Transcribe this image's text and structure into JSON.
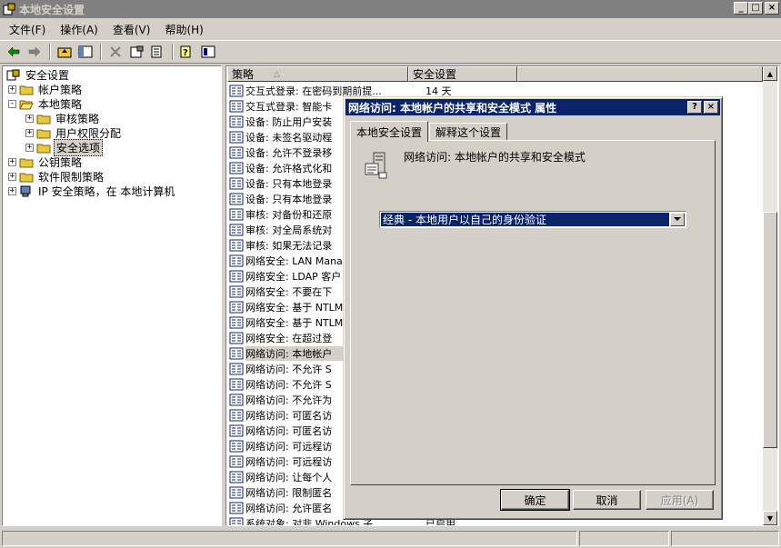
{
  "window": {
    "title": "本地安全设置",
    "min_glyph": "_",
    "max_glyph": "□",
    "close_glyph": "×"
  },
  "menu": [
    "文件(F)",
    "操作(A)",
    "查看(V)",
    "帮助(H)"
  ],
  "toolbar": {
    "icons": [
      "back-arrow-icon",
      "forward-arrow-icon",
      "up-folder-icon",
      "show-tree-icon",
      "delete-icon",
      "properties-icon",
      "export-list-icon",
      "help-icon",
      "console-icon"
    ]
  },
  "tree": {
    "root": "安全设置",
    "items": [
      {
        "label": "帐户策略",
        "level": 1,
        "expander": "+"
      },
      {
        "label": "本地策略",
        "level": 1,
        "expander": "-"
      },
      {
        "label": "审核策略",
        "level": 2,
        "expander": "+"
      },
      {
        "label": "用户权限分配",
        "level": 2,
        "expander": "+"
      },
      {
        "label": "安全选项",
        "level": 2,
        "expander": "+",
        "selected": true
      },
      {
        "label": "公钥策略",
        "level": 1,
        "expander": "+"
      },
      {
        "label": "软件限制策略",
        "level": 1,
        "expander": "+"
      },
      {
        "label": "IP 安全策略，在 本地计算机",
        "level": 1,
        "expander": "+"
      }
    ]
  },
  "list": {
    "columns": [
      "策略",
      "安全设置"
    ],
    "rows": [
      {
        "name": "交互式登录: 在密码到期前提...",
        "value": "14 天"
      },
      {
        "name": "交互式登录: 智能卡",
        "value": ""
      },
      {
        "name": "设备: 防止用户安装",
        "value": ""
      },
      {
        "name": "设备: 未签名驱动程",
        "value": ""
      },
      {
        "name": "设备: 允许不登录移",
        "value": ""
      },
      {
        "name": "设备: 允许格式化和",
        "value": ""
      },
      {
        "name": "设备: 只有本地登录",
        "value": ""
      },
      {
        "name": "设备: 只有本地登录",
        "value": ""
      },
      {
        "name": "审核: 对备份和还原",
        "value": ""
      },
      {
        "name": "审核: 对全局系统对",
        "value": ""
      },
      {
        "name": "审核: 如果无法记录",
        "value": ""
      },
      {
        "name": "网络安全: LAN Mana",
        "value": ""
      },
      {
        "name": "网络安全: LDAP 客户",
        "value": ""
      },
      {
        "name": "网络安全: 不要在下",
        "value": ""
      },
      {
        "name": "网络安全: 基于 NTLM",
        "value": ""
      },
      {
        "name": "网络安全: 基于 NTLM",
        "value": ""
      },
      {
        "name": "网络安全: 在超过登",
        "value": ""
      },
      {
        "name": "网络访问: 本地帐户",
        "value": "",
        "highlight": true
      },
      {
        "name": "网络访问: 不允许 S",
        "value": ""
      },
      {
        "name": "网络访问: 不允许 S",
        "value": ""
      },
      {
        "name": "网络访问: 不允许为",
        "value": ""
      },
      {
        "name": "网络访问: 可匿名访",
        "value": ""
      },
      {
        "name": "网络访问: 可匿名访",
        "value": ""
      },
      {
        "name": "网络访问: 可远程访",
        "value": ""
      },
      {
        "name": "网络访问: 可远程访",
        "value": ""
      },
      {
        "name": "网络访问: 让每个人",
        "value": ""
      },
      {
        "name": "网络访问: 限制匿名",
        "value": ""
      },
      {
        "name": "网络访问: 允许匿名",
        "value": ""
      },
      {
        "name": "系统对象: 对非 Windows 子...",
        "value": "已启用"
      }
    ]
  },
  "dialog": {
    "title": "网络访问: 本地帐户的共享和安全模式 属性",
    "help_glyph": "?",
    "close_glyph": "×",
    "tabs": [
      "本地安全设置",
      "解释这个设置"
    ],
    "policy_name": "网络访问: 本地帐户的共享和安全模式",
    "select_value": "经典 - 本地用户以自己的身份验证",
    "buttons": {
      "ok": "确定",
      "cancel": "取消",
      "apply": "应用(A)"
    }
  }
}
